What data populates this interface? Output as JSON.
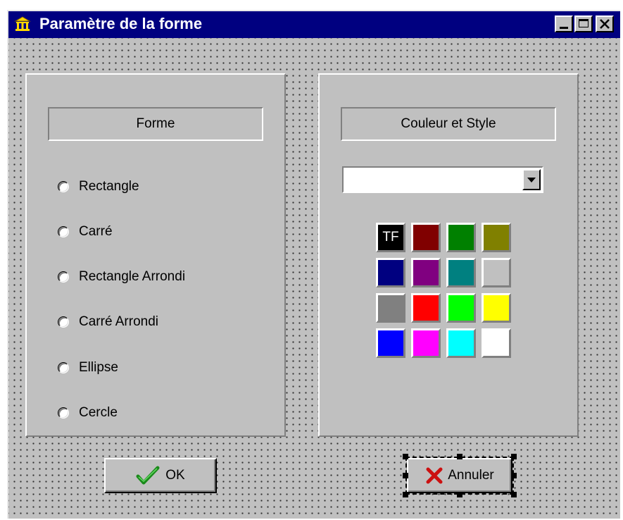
{
  "window": {
    "title": "Paramètre de la forme",
    "icon": "building-icon",
    "controls": [
      "minimize",
      "maximize",
      "close"
    ]
  },
  "shape_panel": {
    "header": "Forme",
    "options": [
      {
        "label": "Rectangle",
        "checked": false
      },
      {
        "label": "Carré",
        "checked": false
      },
      {
        "label": "Rectangle Arrondi",
        "checked": false
      },
      {
        "label": "Carré Arrondi",
        "checked": false
      },
      {
        "label": "Ellipse",
        "checked": false
      },
      {
        "label": "Cercle",
        "checked": false
      }
    ]
  },
  "color_panel": {
    "header": "Couleur et Style",
    "style_select_value": "",
    "swatches": [
      {
        "color": "#000000",
        "label": "TF"
      },
      {
        "color": "#800000"
      },
      {
        "color": "#008000"
      },
      {
        "color": "#808000"
      },
      {
        "color": "#000080"
      },
      {
        "color": "#800080"
      },
      {
        "color": "#008080"
      },
      {
        "color": "#c0c0c0"
      },
      {
        "color": "#808080"
      },
      {
        "color": "#ff0000"
      },
      {
        "color": "#00ff00"
      },
      {
        "color": "#ffff00"
      },
      {
        "color": "#0000ff"
      },
      {
        "color": "#ff00ff"
      },
      {
        "color": "#00ffff"
      },
      {
        "color": "#ffffff"
      }
    ]
  },
  "buttons": {
    "ok_label": "OK",
    "cancel_label": "Annuler",
    "ok_icon": "checkmark-icon",
    "cancel_icon": "cross-icon"
  }
}
